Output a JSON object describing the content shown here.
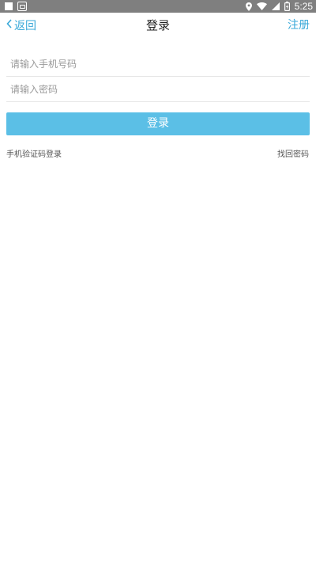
{
  "status_bar": {
    "time": "5:25",
    "icons": [
      "notification-square-icon",
      "app-notification-icon",
      "location-icon",
      "wifi-icon",
      "signal-icon",
      "battery-icon"
    ]
  },
  "navbar": {
    "back_label": "返回",
    "title": "登录",
    "register_label": "注册"
  },
  "form": {
    "phone_placeholder": "请输入手机号码",
    "password_placeholder": "请输入密码",
    "login_label": "登录"
  },
  "links": {
    "sms_login": "手机验证码登录",
    "forgot_password": "找回密码"
  },
  "colors": {
    "accent": "#3aa9d9",
    "button": "#5bbfe6",
    "status_bar": "#7f7f7f"
  }
}
